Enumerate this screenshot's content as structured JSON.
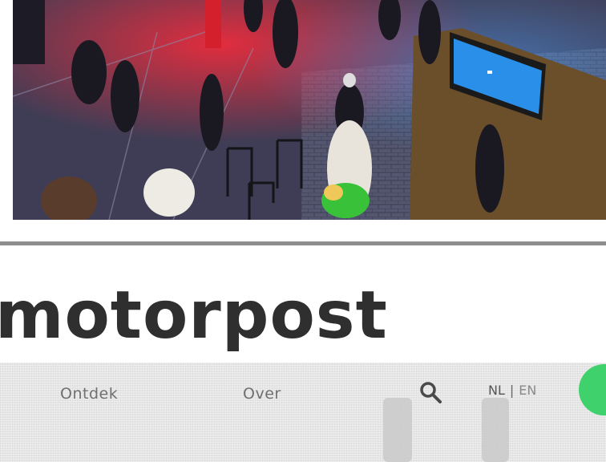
{
  "header": {
    "headline": "motorpost"
  },
  "embedded_screen": {
    "nav": {
      "discover_label": "Ontdek",
      "about_label": "Over"
    },
    "language": {
      "nl_label": "NL",
      "separator": "|",
      "en_label": "EN"
    }
  },
  "colors": {
    "headline": "#2f2f2f",
    "divider": "#8e8e8e",
    "accent_green": "#3fd16b",
    "screen_background": "#e6e6e6"
  },
  "icons": {
    "search": "search-icon"
  }
}
